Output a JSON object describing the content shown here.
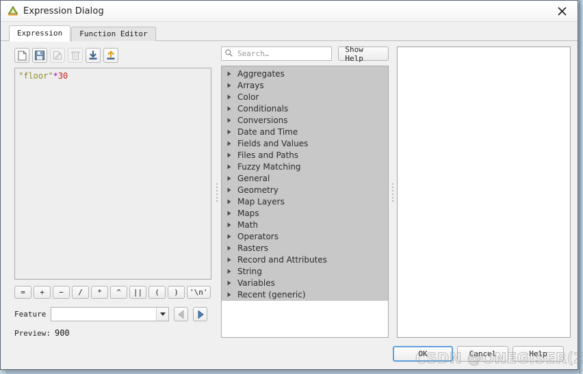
{
  "window": {
    "title": "Expression Dialog",
    "app_icon": "qgis-logo-icon",
    "close_label": "✕"
  },
  "tabs": [
    {
      "label": "Expression",
      "active": true
    },
    {
      "label": "Function Editor",
      "active": false
    }
  ],
  "expression_toolbar": [
    {
      "name": "new-expression-button",
      "icon": "new-file-icon",
      "disabled": false
    },
    {
      "name": "save-expression-button",
      "icon": "save-icon",
      "disabled": false
    },
    {
      "name": "edit-expression-button",
      "icon": "pencil-icon",
      "disabled": true
    },
    {
      "name": "delete-expression-button",
      "icon": "trash-icon",
      "disabled": true
    },
    {
      "name": "import-expression-button",
      "icon": "import-icon",
      "disabled": false
    },
    {
      "name": "export-expression-button",
      "icon": "export-icon",
      "disabled": false
    }
  ],
  "editor": {
    "tokens": [
      {
        "text": "\"floor\"",
        "kind": "field"
      },
      {
        "text": "*",
        "kind": "operator"
      },
      {
        "text": "30",
        "kind": "number"
      }
    ],
    "plain_text": "\"floor\"*30",
    "colors": {
      "field": "#8d8b2a",
      "operator": "#b000b0",
      "number": "#cc2222"
    }
  },
  "operator_buttons": [
    "=",
    "+",
    "−",
    "/",
    "*",
    "^",
    "||",
    "(",
    ")",
    "'\\n'"
  ],
  "feature": {
    "label": "Feature",
    "value": "",
    "placeholder": "",
    "prev_button": "previous-feature-button",
    "next_button": "next-feature-button",
    "prev_disabled": true,
    "next_disabled": false
  },
  "preview": {
    "label": "Preview:",
    "value": "900"
  },
  "search": {
    "placeholder": "Search…",
    "value": "",
    "icon": "search-icon"
  },
  "show_help_button": "Show Help",
  "function_tree": [
    "Aggregates",
    "Arrays",
    "Color",
    "Conditionals",
    "Conversions",
    "Date and Time",
    "Fields and Values",
    "Files and Paths",
    "Fuzzy Matching",
    "General",
    "Geometry",
    "Map Layers",
    "Maps",
    "Math",
    "Operators",
    "Rasters",
    "Record and Attributes",
    "String",
    "Variables",
    "Recent (generic)"
  ],
  "help_panel": {
    "content": ""
  },
  "footer_buttons": [
    {
      "label": "OK",
      "name": "ok-button",
      "default": true
    },
    {
      "label": "Cancel",
      "name": "cancel-button",
      "default": false
    },
    {
      "label": "Help",
      "name": "help-button",
      "default": false
    }
  ],
  "watermark": "CSDN @ONEGISER(ZPC)",
  "accent": {
    "focus_blue": "#5f9fd8",
    "nav_blue": "#4a7fb5",
    "tree_bg": "#c8c8c8"
  }
}
